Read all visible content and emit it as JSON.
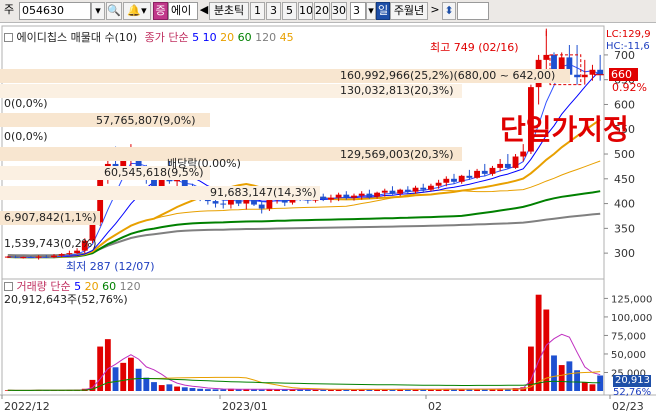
{
  "toolbar": {
    "market_label": "주",
    "code": "054630",
    "search_icon": "search-icon",
    "sound_icon": "speaker-icon",
    "badge": "증",
    "name": "에이",
    "arrow_left": "◀",
    "period_label": "분초틱",
    "intervals": [
      "1",
      "3",
      "5",
      "10",
      "20",
      "30"
    ],
    "count": "3",
    "unit_sel": "일",
    "unit_rest": "주월년",
    "arrow_right": ">",
    "updown": "⬍"
  },
  "price_legend": {
    "title": "에이디칩스 매물대 수(10)",
    "ma_label": "종가 단순",
    "ma_periods": [
      "5",
      "10",
      "20",
      "60",
      "120",
      "45"
    ],
    "ma_colors": [
      "#0000ff",
      "#0000ff",
      "#e8a000",
      "#008000",
      "#808080",
      "#e8a000"
    ]
  },
  "right_info": {
    "lc": "LC:129,9",
    "hc": "HC:-11,6"
  },
  "price_axis": [
    "700",
    "650",
    "600",
    "550",
    "500",
    "450",
    "400",
    "350",
    "300"
  ],
  "current_price": "660",
  "current_pct": "0.92%",
  "high_note": "최고 749 (02/16)",
  "low_note": "최저 287 (12/07)",
  "dividend_note": "배당락(0.00%)",
  "overlay_text": "단일가지정",
  "volume_profile": [
    "160,992,966(25,2%)(680,00 ~ 642,00)",
    "130,032,813(20,3%)",
    "0(0,0%)",
    "57,765,807(9,0%)",
    "0(0,0%)",
    "129,569,003(20,3%)",
    "60,545,618(9,5%)",
    "91,683,147(14,3%)",
    "6,907,842(1,1%)",
    "1,539,743(0,2%)"
  ],
  "volume_legend": {
    "label": "거래량 단순",
    "periods": [
      "5",
      "20",
      "60",
      "120"
    ]
  },
  "volume_value": "20,912,643주(52,76%)",
  "volume_axis": [
    "125,000",
    "100,000",
    "75,000",
    "50,000",
    "25,000"
  ],
  "volume_current": "20,913",
  "volume_current_pct": "52,76%",
  "date_axis": [
    "2022/12",
    "2023/01",
    "02",
    "02/23"
  ],
  "chart_data": {
    "type": "candlestick",
    "ylim": [
      270,
      720
    ],
    "candles": [
      [
        292,
        294,
        290,
        293
      ],
      [
        293,
        295,
        290,
        291
      ],
      [
        291,
        293,
        289,
        292
      ],
      [
        292,
        294,
        290,
        291
      ],
      [
        291,
        296,
        287,
        293
      ],
      [
        293,
        296,
        290,
        292
      ],
      [
        292,
        298,
        290,
        295
      ],
      [
        295,
        300,
        292,
        298
      ],
      [
        298,
        305,
        296,
        300
      ],
      [
        300,
        310,
        298,
        305
      ],
      [
        305,
        330,
        300,
        325
      ],
      [
        325,
        365,
        320,
        362
      ],
      [
        362,
        470,
        355,
        465
      ],
      [
        465,
        510,
        440,
        480
      ],
      [
        480,
        515,
        460,
        470
      ],
      [
        470,
        495,
        455,
        490
      ],
      [
        490,
        520,
        475,
        500
      ],
      [
        500,
        508,
        455,
        462
      ],
      [
        462,
        478,
        440,
        455
      ],
      [
        455,
        468,
        425,
        430
      ],
      [
        430,
        462,
        420,
        450
      ],
      [
        450,
        500,
        440,
        445
      ],
      [
        445,
        475,
        430,
        455
      ],
      [
        455,
        462,
        420,
        425
      ],
      [
        425,
        440,
        410,
        418
      ],
      [
        418,
        430,
        405,
        412
      ],
      [
        412,
        426,
        398,
        405
      ],
      [
        405,
        418,
        392,
        400
      ],
      [
        400,
        412,
        390,
        398
      ],
      [
        398,
        425,
        390,
        420
      ],
      [
        420,
        428,
        395,
        400
      ],
      [
        400,
        418,
        388,
        412
      ],
      [
        412,
        418,
        395,
        398
      ],
      [
        398,
        405,
        380,
        390
      ],
      [
        390,
        420,
        385,
        415
      ],
      [
        415,
        424,
        400,
        420
      ],
      [
        420,
        428,
        395,
        402
      ],
      [
        402,
        420,
        398,
        418
      ],
      [
        418,
        426,
        405,
        410
      ],
      [
        410,
        416,
        400,
        406
      ],
      [
        406,
        418,
        402,
        414
      ],
      [
        414,
        420,
        405,
        408
      ],
      [
        408,
        418,
        402,
        412
      ],
      [
        412,
        422,
        405,
        418
      ],
      [
        418,
        425,
        408,
        412
      ],
      [
        412,
        420,
        406,
        416
      ],
      [
        416,
        425,
        408,
        420
      ],
      [
        420,
        428,
        410,
        414
      ],
      [
        414,
        424,
        410,
        422
      ],
      [
        422,
        430,
        414,
        426
      ],
      [
        426,
        435,
        418,
        420
      ],
      [
        420,
        430,
        415,
        428
      ],
      [
        428,
        435,
        420,
        424
      ],
      [
        424,
        436,
        420,
        432
      ],
      [
        432,
        440,
        424,
        428
      ],
      [
        428,
        440,
        425,
        436
      ],
      [
        436,
        448,
        430,
        442
      ],
      [
        442,
        455,
        435,
        450
      ],
      [
        450,
        460,
        440,
        444
      ],
      [
        444,
        458,
        440,
        456
      ],
      [
        456,
        468,
        448,
        452
      ],
      [
        452,
        470,
        450,
        466
      ],
      [
        466,
        480,
        455,
        460
      ],
      [
        460,
        476,
        456,
        472
      ],
      [
        472,
        490,
        465,
        480
      ],
      [
        480,
        500,
        470,
        472
      ],
      [
        472,
        500,
        470,
        495
      ],
      [
        495,
        520,
        485,
        505
      ],
      [
        505,
        640,
        500,
        635
      ],
      [
        635,
        700,
        600,
        690
      ],
      [
        690,
        749,
        660,
        700
      ],
      [
        700,
        705,
        650,
        660
      ],
      [
        660,
        705,
        650,
        695
      ],
      [
        695,
        720,
        650,
        660
      ],
      [
        660,
        720,
        640,
        655
      ],
      [
        655,
        690,
        640,
        660
      ],
      [
        660,
        680,
        648,
        670
      ],
      [
        670,
        700,
        648,
        660
      ]
    ],
    "volumes": [
      900,
      800,
      700,
      600,
      1500,
      800,
      900,
      1200,
      1500,
      2000,
      3000,
      15000,
      60000,
      70000,
      32000,
      38000,
      45000,
      30000,
      18000,
      12000,
      8000,
      9000,
      6000,
      5000,
      4000,
      3000,
      2500,
      2200,
      2000,
      3000,
      2500,
      2500,
      2000,
      1800,
      2600,
      2200,
      2000,
      2400,
      2100,
      1900,
      2000,
      1800,
      2100,
      2300,
      2000,
      2100,
      2200,
      2000,
      2300,
      2400,
      2200,
      2300,
      2100,
      2500,
      2300,
      2400,
      2600,
      2800,
      2400,
      2600,
      2500,
      2800,
      2600,
      2900,
      3200,
      3000,
      4000,
      5000,
      60000,
      130000,
      110000,
      48000,
      35000,
      40000,
      28000,
      12000,
      9000,
      20913
    ]
  }
}
